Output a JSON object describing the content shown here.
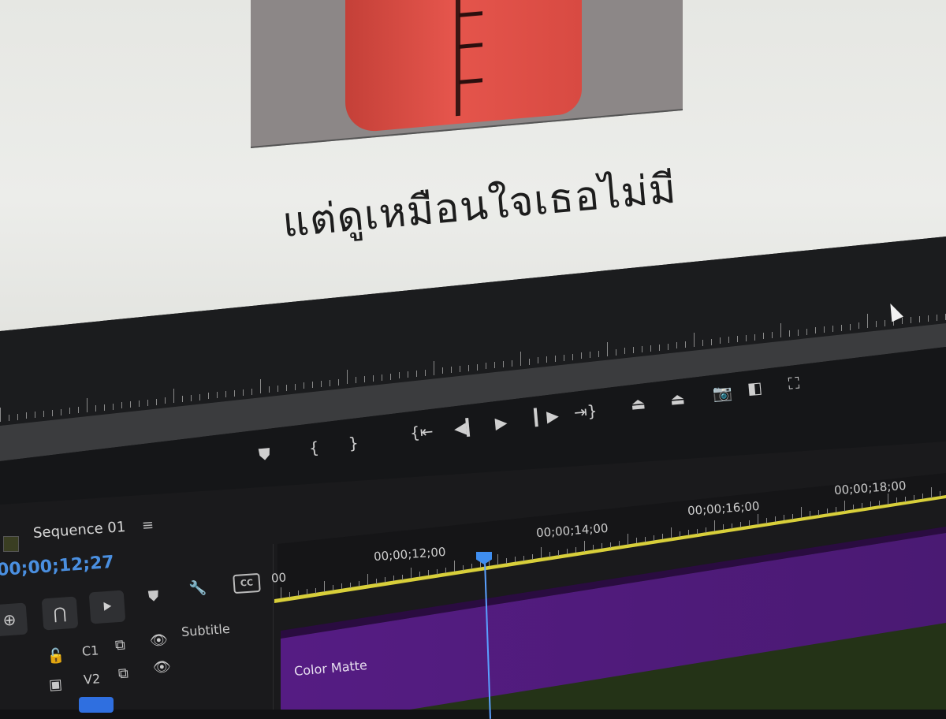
{
  "program_monitor": {
    "subtitle_caption": "แต่ดูเหมือนใจเธอไม่มี"
  },
  "transport_controls": {
    "icons": [
      "add-marker-icon",
      "mark-in-icon",
      "mark-out-icon",
      "go-to-in-icon",
      "step-back-icon",
      "play-icon",
      "step-forward-icon",
      "go-to-out-icon",
      "lift-icon",
      "extract-icon",
      "export-frame-icon",
      "comparison-view-icon",
      "settings-icon"
    ]
  },
  "timeline": {
    "sequence_title": "Sequence 01",
    "menu_glyph": "≡",
    "current_timecode": "00;00;12;27",
    "ruler": {
      "time_labels": [
        "00;00;12;00",
        "00;00;14;00",
        "00;00;16;00",
        "00;00;18;00"
      ],
      "start_fragment": "00"
    },
    "tracks": {
      "subtitle_label": "Subtitle",
      "c1_label": "C1",
      "v2_label": "V2"
    },
    "clip": {
      "name": "Color Matte",
      "color": "#5a1d8a"
    },
    "colors": {
      "playhead": "#3f8ef0",
      "work_area_bar": "#d8cf3a",
      "timecode": "#4a8fe0"
    }
  }
}
